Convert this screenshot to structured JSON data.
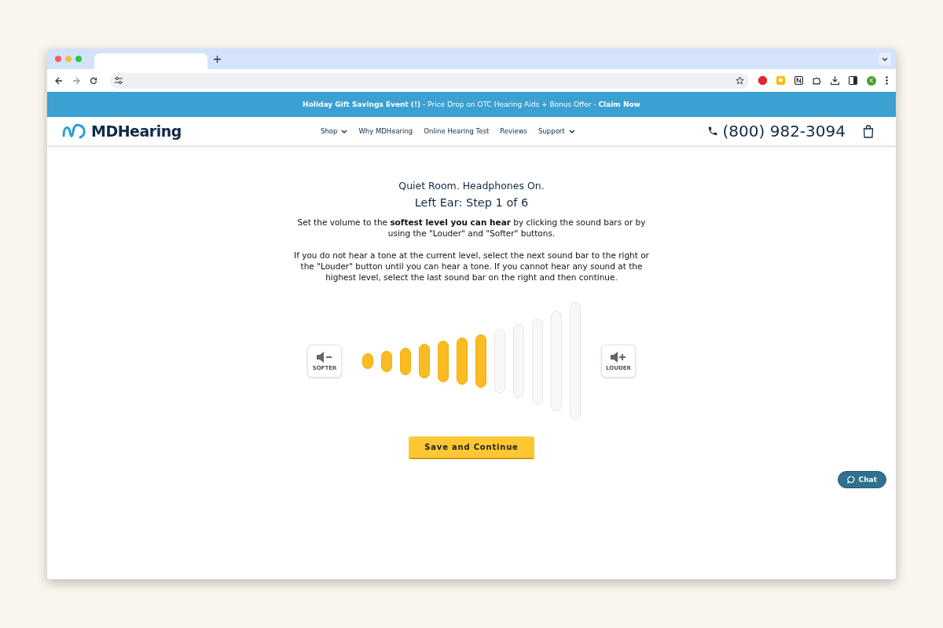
{
  "browser": {
    "avatar": "K"
  },
  "banner": {
    "text": "**Holiday Gift Savings Event (!)** - Price Drop on OTC Hearing Aids + Bonus Offer - **Claim Now**"
  },
  "site": {
    "logo": "MDHearing",
    "nav": [
      {
        "label": "Shop",
        "dropdown": true
      },
      {
        "label": "Why MDHearing",
        "dropdown": false
      },
      {
        "label": "Online Hearing Test",
        "dropdown": false
      },
      {
        "label": "Reviews",
        "dropdown": false
      },
      {
        "label": "Support",
        "dropdown": true
      }
    ],
    "phone": "(800) 982-3094"
  },
  "test": {
    "subtitle": "Quiet Room. Headphones On.",
    "title": "Left Ear: Step 1 of 6",
    "instructions": [
      "Set the volume to the **softest level you can hear** by clicking the sound bars or by using the \"Louder\" and \"Softer\" buttons.",
      "If you do not hear a tone at the current level, select the next sound bar to the right or the \"Louder\" button until you can hear a tone. If you cannot hear any sound at the highest level, select the last sound bar on the right and then continue."
    ],
    "softer_label": "SOFTER",
    "louder_label": "LOUDER",
    "bars": [
      {
        "on": true
      },
      {
        "on": true
      },
      {
        "on": true
      },
      {
        "on": true
      },
      {
        "on": true
      },
      {
        "on": true
      },
      {
        "on": true
      },
      {
        "on": false
      },
      {
        "on": false
      },
      {
        "on": false
      },
      {
        "on": false
      },
      {
        "on": false
      }
    ],
    "save_button": "Save and Continue"
  },
  "chat": {
    "label": "Chat"
  }
}
